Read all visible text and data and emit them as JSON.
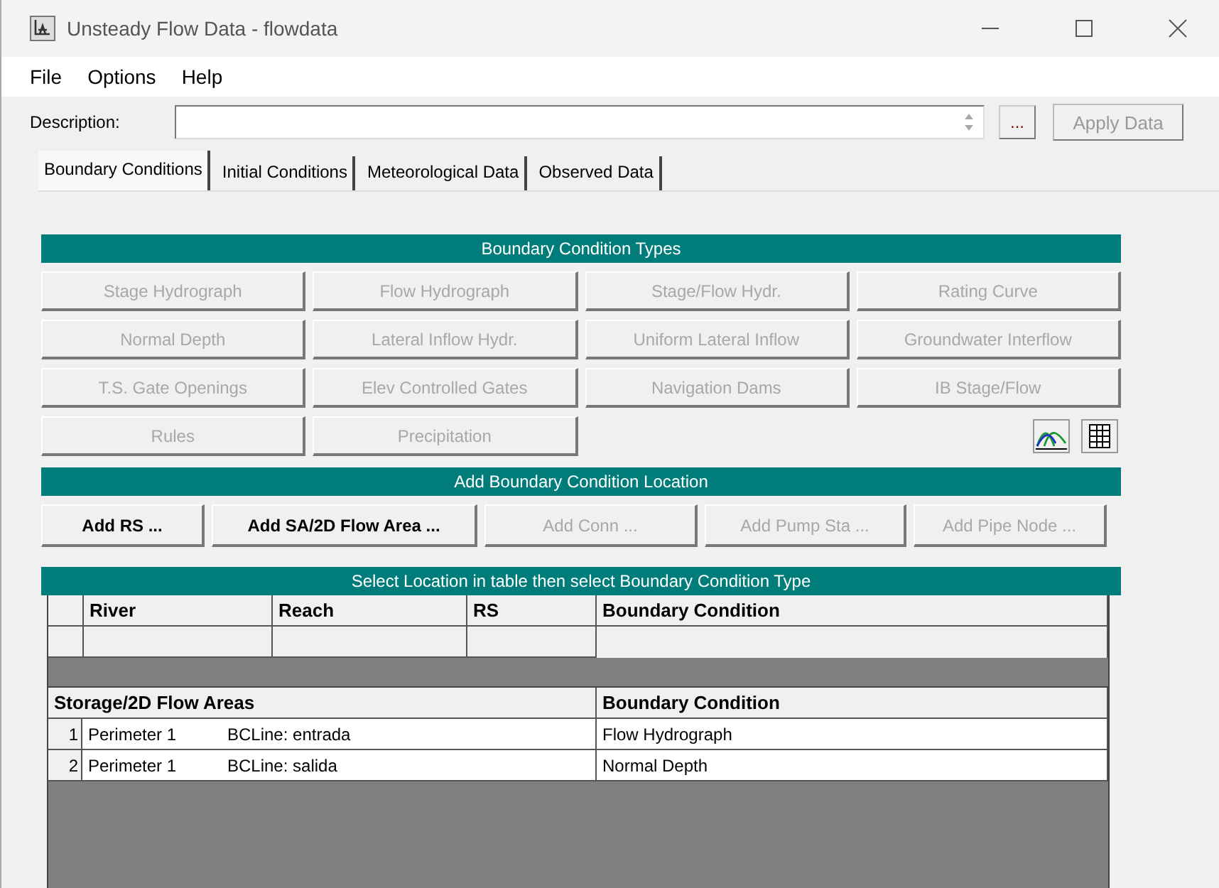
{
  "window": {
    "title": "Unsteady Flow Data - flowdata"
  },
  "menu": [
    "File",
    "Options",
    "Help"
  ],
  "description": {
    "label": "Description:",
    "more_button": "...",
    "apply_button": {
      "label": "Apply Data",
      "disabled": true
    }
  },
  "tabs": [
    {
      "label": "Boundary Conditions",
      "selected": true
    },
    {
      "label": "Initial Conditions",
      "selected": false
    },
    {
      "label": "Meteorological Data",
      "selected": false
    },
    {
      "label": "Observed Data",
      "selected": false
    }
  ],
  "types": {
    "title": "Boundary Condition Types",
    "buttons": [
      {
        "label": "Stage Hydrograph",
        "disabled": true
      },
      {
        "label": "Flow Hydrograph",
        "disabled": true
      },
      {
        "label": "Stage/Flow Hydr.",
        "disabled": true
      },
      {
        "label": "Rating Curve",
        "disabled": true
      },
      {
        "label": "Normal Depth",
        "disabled": true
      },
      {
        "label": "Lateral Inflow Hydr.",
        "disabled": true
      },
      {
        "label": "Uniform Lateral Inflow",
        "disabled": true
      },
      {
        "label": "Groundwater Interflow",
        "disabled": true
      },
      {
        "label": "T.S. Gate Openings",
        "disabled": true
      },
      {
        "label": "Elev Controlled Gates",
        "disabled": true
      },
      {
        "label": "Navigation Dams",
        "disabled": true
      },
      {
        "label": "IB Stage/Flow",
        "disabled": true
      },
      {
        "label": "Rules",
        "disabled": true
      },
      {
        "label": "Precipitation",
        "disabled": true
      }
    ]
  },
  "location": {
    "title": "Add Boundary Condition Location",
    "buttons": [
      {
        "label": "Add RS ...",
        "disabled": false
      },
      {
        "label": "Add SA/2D Flow Area ...",
        "disabled": false
      },
      {
        "label": "Add Conn ...",
        "disabled": true
      },
      {
        "label": "Add Pump Sta ...",
        "disabled": true
      },
      {
        "label": "Add Pipe Node ...",
        "disabled": true
      }
    ]
  },
  "table": {
    "title": "Select Location in table then select Boundary Condition Type",
    "columns": [
      "River",
      "Reach",
      "RS",
      "Boundary Condition"
    ],
    "storage_columns": [
      "Storage/2D Flow Areas",
      "Boundary Condition"
    ],
    "storage_rows": [
      {
        "number": "1",
        "area": "Perimeter 1",
        "line": "BCLine: entrada",
        "condition": "Flow Hydrograph"
      },
      {
        "number": "2",
        "area": "Perimeter 1",
        "line": "BCLine: salida",
        "condition": "Normal Depth"
      }
    ]
  }
}
